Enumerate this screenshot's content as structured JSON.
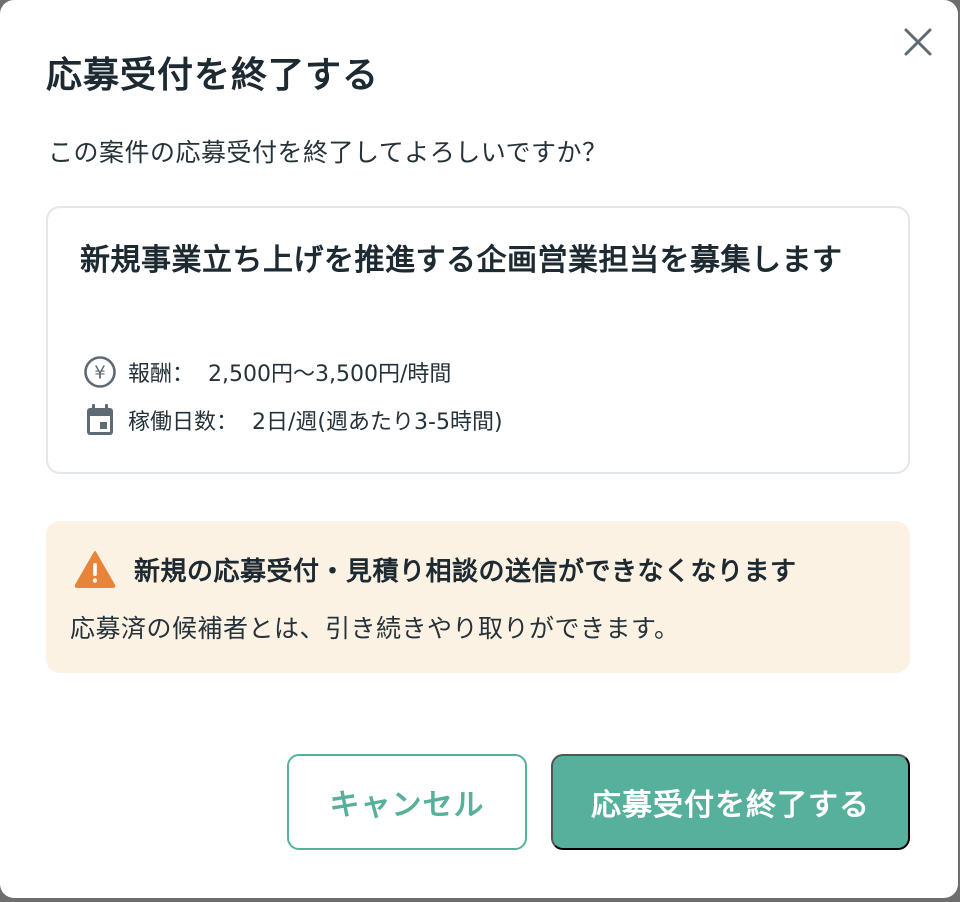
{
  "dialog": {
    "title": "応募受付を終了する",
    "question": "この案件の応募受付を終了してよろしいですか？",
    "close_icon": "close-icon"
  },
  "job": {
    "title": "新規事業立ち上げを推進する企画営業担当を募集します",
    "reward_label": "報酬：",
    "reward_value": "2,500円〜3,500円/時間",
    "reward_icon": "yen-circle-icon",
    "days_label": "稼働日数：",
    "days_value": "2日/週(週あたり3-5時間)",
    "days_icon": "calendar-icon"
  },
  "warning": {
    "icon": "warning-triangle-icon",
    "title": "新規の応募受付・見積り相談の送信ができなくなります",
    "body": "応募済の候補者とは、引き続きやり取りができます。"
  },
  "actions": {
    "cancel_label": "キャンセル",
    "confirm_label": "応募受付を終了する"
  },
  "colors": {
    "accent": "#57b09b",
    "warning_bg": "#fcf2e3",
    "warning_icon": "#e8833a",
    "text": "#1e2a32"
  }
}
